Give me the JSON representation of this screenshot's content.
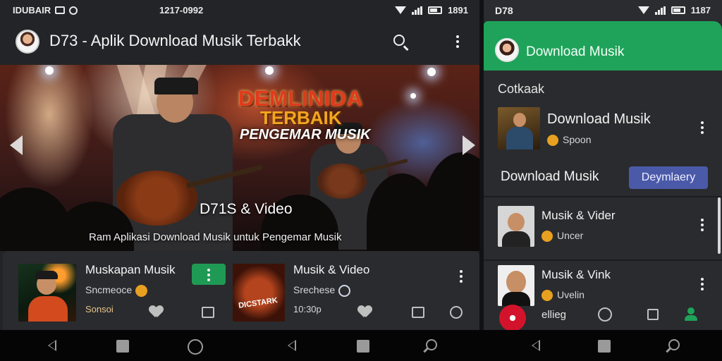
{
  "left_screen": {
    "status": {
      "left": "IDUBAIR",
      "center": "1217-0992",
      "time": "1891"
    },
    "app_title": "D73 - Aplik Download Musik Terbakk",
    "hero": {
      "title_line1": "DEMLINIDA",
      "title_line2": "TERBAIK",
      "title_line3": "PENGEMAR MUSIK",
      "caption": "D71S & Video",
      "subtitle": "Ram Aplikasi Download Musik untuk Pengemar Musik"
    },
    "cards": [
      {
        "title": "Muskapan Musik",
        "subtitle": "Sncmeoce",
        "meta": "Sonsoi",
        "thumb_text": ""
      },
      {
        "title": "Musik & Video",
        "subtitle": "Srechese",
        "meta": "10:30p",
        "thumb_text": "DICSTARK"
      }
    ]
  },
  "right_screen": {
    "status": {
      "left": "D78",
      "time": "1187"
    },
    "drawer_title": "Download Musik",
    "section_label": "Cotkaak",
    "featured": {
      "title": "Download Musik",
      "subtitle": "Spoon"
    },
    "row_header": "Download Musik",
    "row_button": "Deymlaery",
    "list": [
      {
        "title": "Musik & Vider",
        "subtitle": "Uncer"
      },
      {
        "title": "Musik & Vink",
        "subtitle": "Uvelin"
      }
    ],
    "bottom_label": "ellieg"
  },
  "colors": {
    "accent_green": "#1fa35a",
    "button_blue": "#4a5aa8",
    "background": "#232427",
    "fab_red": "#d3132b"
  },
  "icons": [
    "search-icon",
    "more-vert-icon",
    "heart-icon",
    "chart-icon",
    "person-icon",
    "back-icon",
    "home-icon",
    "recents-icon"
  ]
}
